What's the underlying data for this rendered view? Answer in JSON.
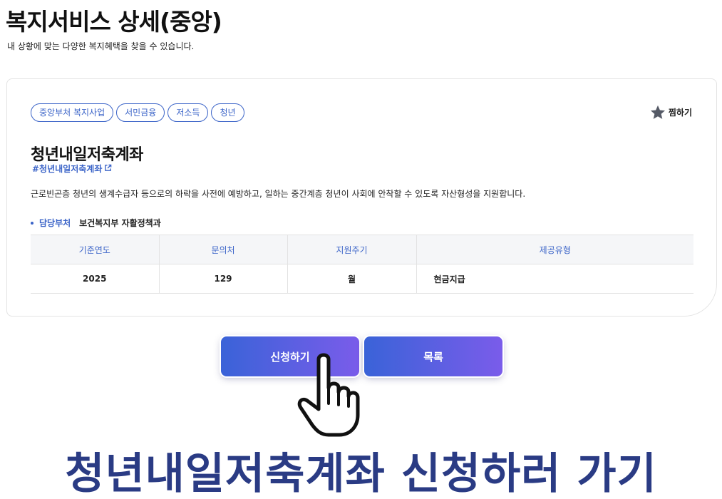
{
  "page": {
    "title": "복지서비스 상세(중앙)",
    "subtitle": "내 상황에 맞는 다양한 복지혜택을 찾을 수 있습니다."
  },
  "service": {
    "tags": [
      "중앙부처 복지사업",
      "서민금융",
      "저소득",
      "청년"
    ],
    "bookmark_label": "찜하기",
    "title": "청년내일저축계좌",
    "hashtag": "#청년내일저축계좌",
    "description": "근로빈곤층 청년의 생계수급자 등으로의 하락을 사전에 예방하고, 일하는 중간계층 청년이 사회에 안착할 수 있도록 자산형성을 지원합니다.",
    "department_label": "담당부처",
    "department_value": "보건복지부 자활정책과"
  },
  "table": {
    "headers": [
      "기준연도",
      "문의처",
      "지원주기",
      "제공유형"
    ],
    "row": [
      "2025",
      "129",
      "월",
      "현금지급"
    ]
  },
  "buttons": {
    "apply_label": "신청하기",
    "list_label": "목록"
  },
  "banner": {
    "text": "청년내일저축계좌 신청하러 가기"
  },
  "icons": {
    "bookmark": "star-icon",
    "external_link": "external-link-icon",
    "cursor": "hand-pointer-icon"
  },
  "colors": {
    "accent": "#3b64c8",
    "button_gradient_start": "#3a63d8",
    "button_gradient_end": "#7a5cea",
    "banner_text": "#2a3b84",
    "table_header_bg": "#f5f6f8"
  }
}
